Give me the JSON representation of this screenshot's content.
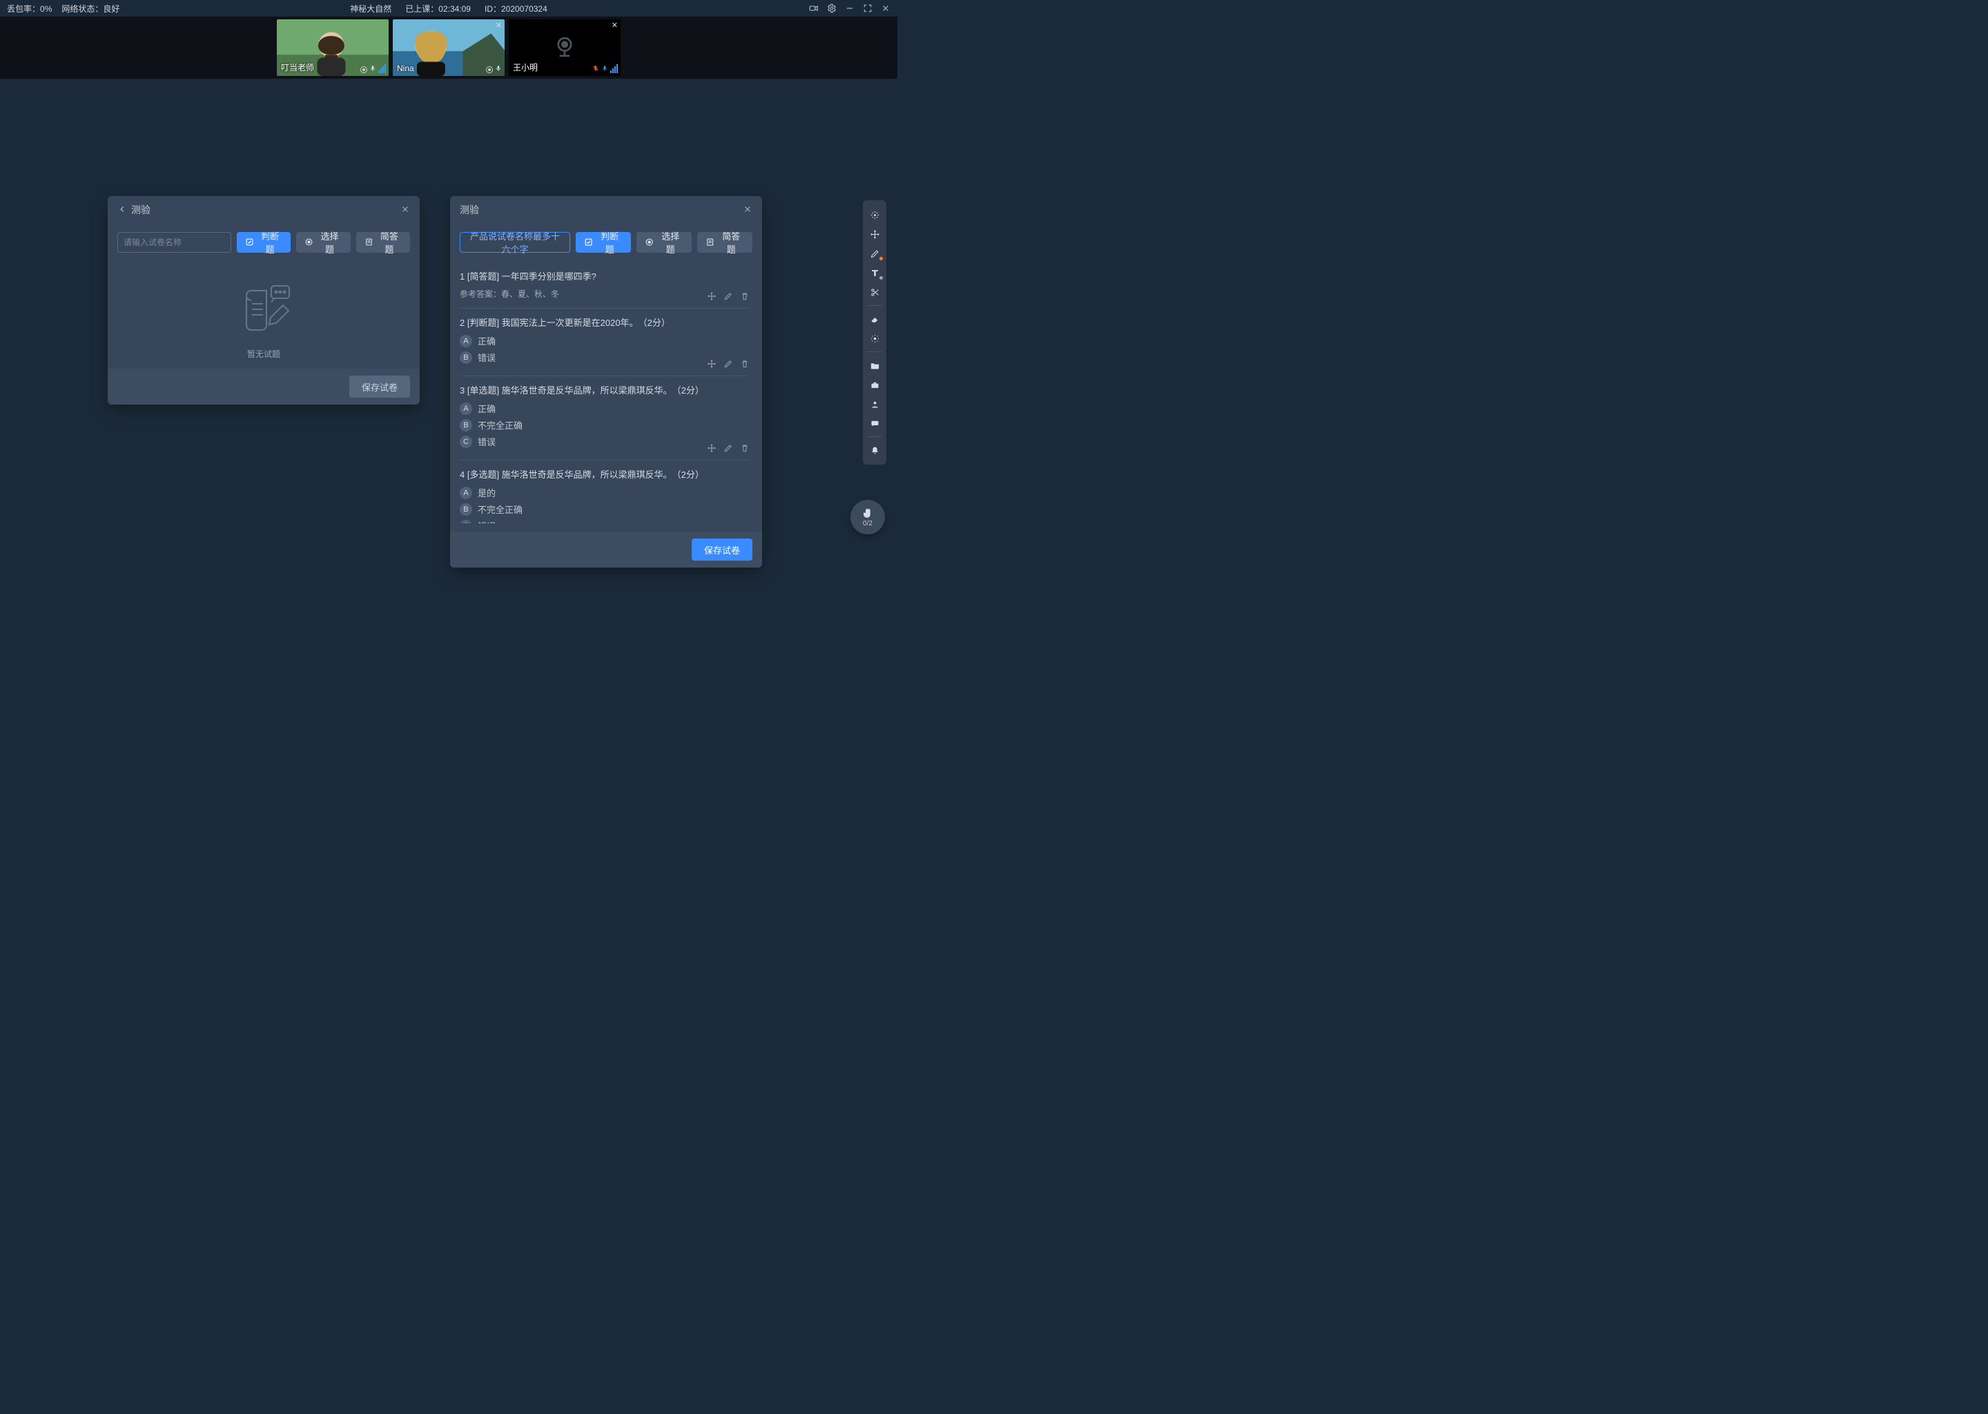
{
  "topbar": {
    "packet_loss_label": "丢包率：",
    "packet_loss_value": "0%",
    "network_label": "网络状态：",
    "network_value": "良好",
    "course_name": "神秘大自然",
    "elapsed_label": "已上课：",
    "elapsed_value": "02:34:09",
    "id_label": "ID：",
    "id_value": "2020070324"
  },
  "participants": [
    {
      "name": "叮当老师",
      "camera": true,
      "closable": false,
      "mic_muted": false
    },
    {
      "name": "Nina",
      "camera": true,
      "closable": true,
      "mic_muted": false
    },
    {
      "name": "王小明",
      "camera": false,
      "closable": true,
      "mic_muted": true
    }
  ],
  "panel_left": {
    "title": "测验",
    "input_placeholder": "请输入试卷名称",
    "btn_judge": "判断题",
    "btn_choice": "选择题",
    "btn_short": "简答题",
    "empty_text": "暂无试题",
    "save_label": "保存试卷"
  },
  "panel_right": {
    "title": "测验",
    "name_value": "产品说试卷名称最多十六个字",
    "btn_judge": "判断题",
    "btn_choice": "选择题",
    "btn_short": "简答题",
    "save_label": "保存试卷",
    "answer_prefix": "参考答案：",
    "questions": [
      {
        "idx": "1",
        "type_tag": "[简答题]",
        "text": "一年四季分别是哪四季?",
        "answer": "春、夏、秋、冬",
        "options": []
      },
      {
        "idx": "2",
        "type_tag": "[判断题]",
        "text": "我国宪法上一次更新是在2020年。",
        "score": "（2分）",
        "options": [
          {
            "k": "A",
            "v": "正确"
          },
          {
            "k": "B",
            "v": "错误"
          }
        ]
      },
      {
        "idx": "3",
        "type_tag": "[单选题]",
        "text": "施华洛世奇是反华品牌，所以梁鼎琪反华。",
        "score": "（2分）",
        "options": [
          {
            "k": "A",
            "v": "正确"
          },
          {
            "k": "B",
            "v": "不完全正确"
          },
          {
            "k": "C",
            "v": "错误"
          }
        ]
      },
      {
        "idx": "4",
        "type_tag": "[多选题]",
        "text": "施华洛世奇是反华品牌，所以梁鼎琪反华。",
        "score": "（2分）",
        "options": [
          {
            "k": "A",
            "v": "是的"
          },
          {
            "k": "B",
            "v": "不完全正确"
          },
          {
            "k": "C",
            "v": "错误"
          }
        ]
      }
    ]
  },
  "hand": {
    "count": "0/2"
  }
}
